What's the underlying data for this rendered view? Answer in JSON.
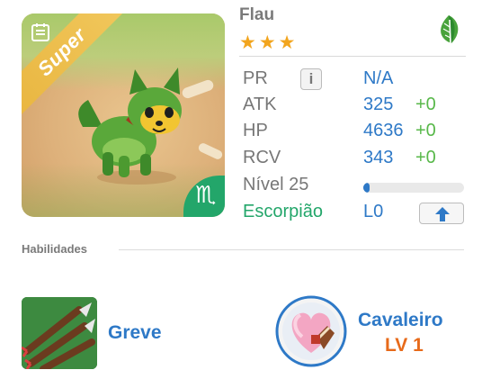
{
  "monster": {
    "name": "Flau",
    "stars": 3,
    "rarity_badge": "Super",
    "element_icon": "leaf-icon",
    "zodiac_symbol": "♏"
  },
  "stats": {
    "pr_label": "PR",
    "pr_value": "N/A",
    "atk_label": "ATK",
    "atk_value": "325",
    "atk_bonus": "+0",
    "hp_label": "HP",
    "hp_value": "4636",
    "hp_bonus": "+0",
    "rcv_label": "RCV",
    "rcv_value": "343",
    "rcv_bonus": "+0",
    "level_label": "Nível 25",
    "level_progress": 0.06,
    "zodiac_label": "Escorpião",
    "zodiac_level": "L0"
  },
  "skills": {
    "section_title": "Habilidades",
    "skill_name": "Greve",
    "leader_name": "Cavaleiro",
    "leader_level": "LV 1"
  },
  "colors": {
    "accent_blue": "#2e79c7",
    "bonus_green": "#58b84a",
    "zodiac_green": "#23a66a",
    "star_gold": "#f2a51e",
    "level_orange": "#e76a1a"
  }
}
